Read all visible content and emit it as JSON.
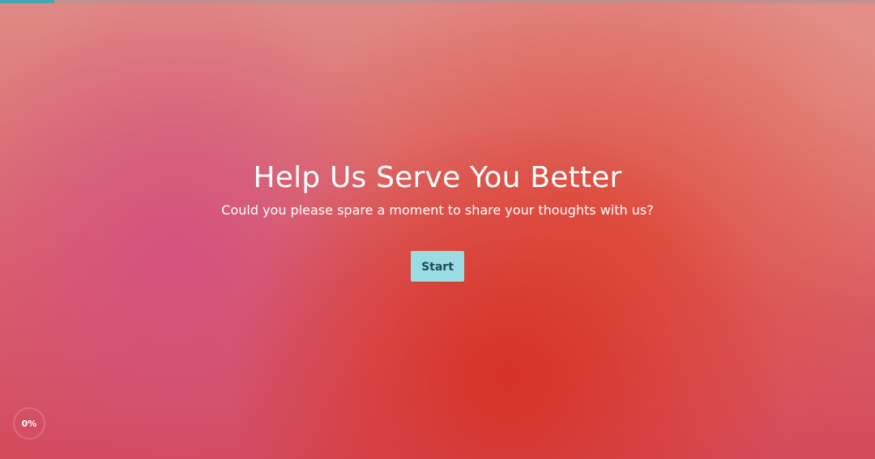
{
  "survey": {
    "title": "Help Us Serve You Better",
    "subtitle": "Could you please spare a moment to share your thoughts with us?",
    "start_label": "Start"
  },
  "progress": {
    "label": "0%",
    "value": 0
  },
  "colors": {
    "button_bg": "#99dde3",
    "button_text": "#1f4c55",
    "top_bar_fill": "#3fa8b4",
    "background_primary": "#d6322a",
    "background_accent": "#d25082"
  }
}
